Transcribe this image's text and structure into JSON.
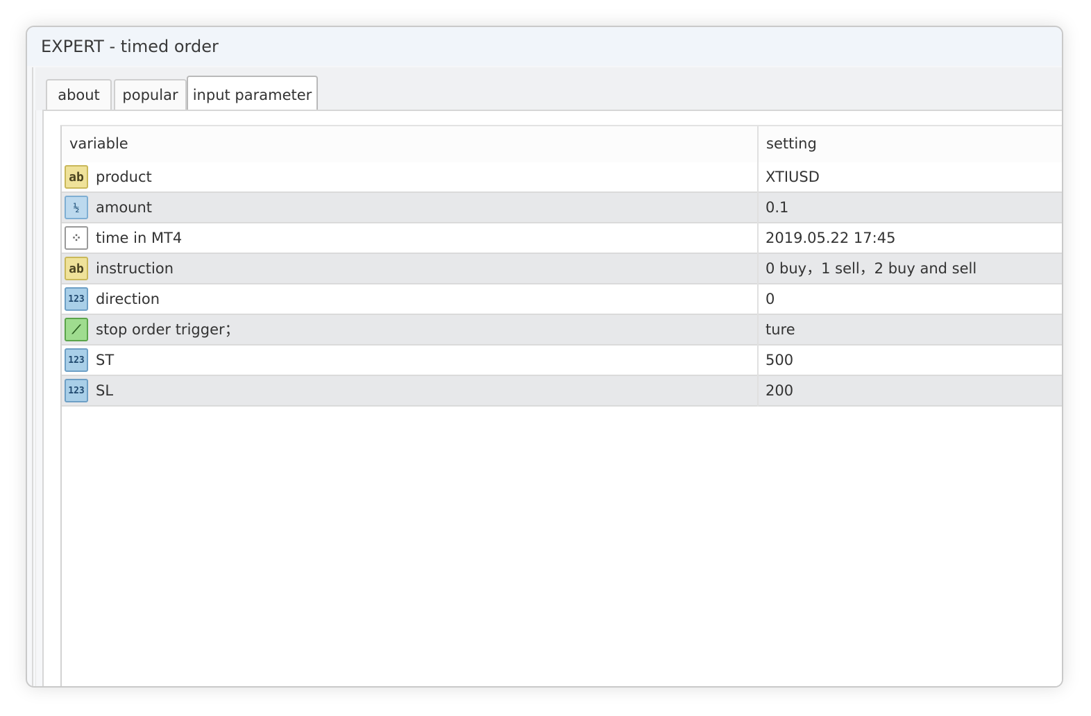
{
  "window": {
    "title": "EXPERT - timed order"
  },
  "tabs": [
    {
      "label": "about"
    },
    {
      "label": "popular"
    },
    {
      "label": "input parameter"
    }
  ],
  "grid": {
    "headers": {
      "variable": "variable",
      "setting": "setting"
    },
    "rows": [
      {
        "icon": "string-type-icon",
        "icon_glyph": "ab",
        "name": "product",
        "value": "XTIUSD"
      },
      {
        "icon": "double-type-icon",
        "icon_glyph": "½",
        "name": "amount",
        "value": "0.1"
      },
      {
        "icon": "datetime-type-icon",
        "icon_glyph": "⁘",
        "name": "time in MT4",
        "value": "2019.05.22 17:45"
      },
      {
        "icon": "string-type-icon",
        "icon_glyph": "ab",
        "name": "instruction",
        "value": "0 buy，1 sell，2 buy and sell"
      },
      {
        "icon": "integer-type-icon",
        "icon_glyph": "123",
        "name": "direction",
        "value": "0"
      },
      {
        "icon": "boolean-type-icon",
        "icon_glyph": "⟋",
        "name": "stop order trigger；",
        "value": "ture"
      },
      {
        "icon": "integer-type-icon",
        "icon_glyph": "123",
        "name": "ST",
        "value": "500"
      },
      {
        "icon": "integer-type-icon",
        "icon_glyph": "123",
        "name": "SL",
        "value": "200"
      }
    ]
  }
}
